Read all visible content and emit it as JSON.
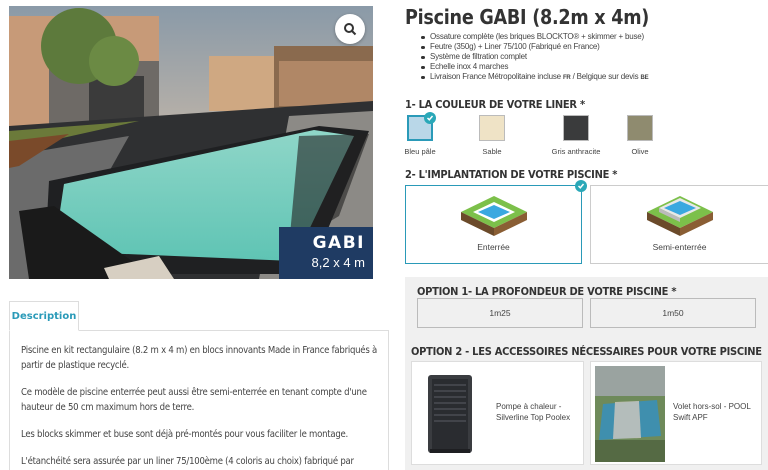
{
  "product": {
    "title": "Piscine GABI (8.2m x 4m)",
    "features": [
      "Ossature complète (les briques BLOCKTO® + skimmer + buse)",
      "Feutre (350g) + Liner 75/100 (Fabriqué en France)",
      "Système de filtration complet",
      "Echelle inox 4 marches",
      "Livraison France Métropolitaine incluse"
    ],
    "delivery_suffix_fr": "FR",
    "delivery_mid": " / Belgique sur devis ",
    "delivery_suffix_be": "BE"
  },
  "photo": {
    "badge_title": "GABI",
    "badge_size": "8,2 x 4 m",
    "zoom_icon": "search-icon"
  },
  "description": {
    "tab_label": "Description",
    "paragraphs": [
      "Piscine en kit rectangulaire (8.2 m x 4 m) en blocs innovants Made in France fabriqués à partir de plastique recyclé.",
      "Ce modèle de piscine enterrée peut aussi être semi-enterrée en tenant compte d'une hauteur de 50 cm maximum hors de terre.",
      "Les blocks skimmer et buse sont déjà pré-montés pour vous faciliter le montage.",
      "L'étanchéité sera assurée par un liner 75/100ème (4 coloris au choix) fabriqué par"
    ]
  },
  "liner": {
    "heading": "1- LA COULEUR DE VOTRE LINER *",
    "swatches": [
      {
        "label": "Bleu pâle",
        "color": "#b9d7e8",
        "selected": true
      },
      {
        "label": "Sable",
        "color": "#efe3c6",
        "selected": false
      },
      {
        "label": "Gris anthracite",
        "color": "#3a3b3c",
        "selected": false
      },
      {
        "label": "Olive",
        "color": "#8f8b6f",
        "selected": false
      }
    ]
  },
  "implantation": {
    "heading": "2- L'IMPLANTATION DE VOTRE PISCINE *",
    "options": [
      {
        "label": "Enterrée",
        "selected": true
      },
      {
        "label": "Semi-enterrée",
        "selected": false
      }
    ]
  },
  "depth": {
    "heading": "OPTION 1- LA PROFONDEUR DE VOTRE PISCINE *",
    "options": [
      "1m25",
      "1m50"
    ]
  },
  "accessories": {
    "heading": "OPTION 2 - LES ACCESSOIRES NÉCESSAIRES POUR VOTRE PISCINE",
    "items": [
      {
        "label_line1": "Pompe à chaleur -",
        "label_line2": "Silverline Top Poolex"
      },
      {
        "label_line1": "Volet hors-sol - POOL",
        "label_line2": "Swift APF"
      }
    ]
  },
  "colors": {
    "accent": "#2a9ab8",
    "badge_bg": "#1f3b63"
  }
}
